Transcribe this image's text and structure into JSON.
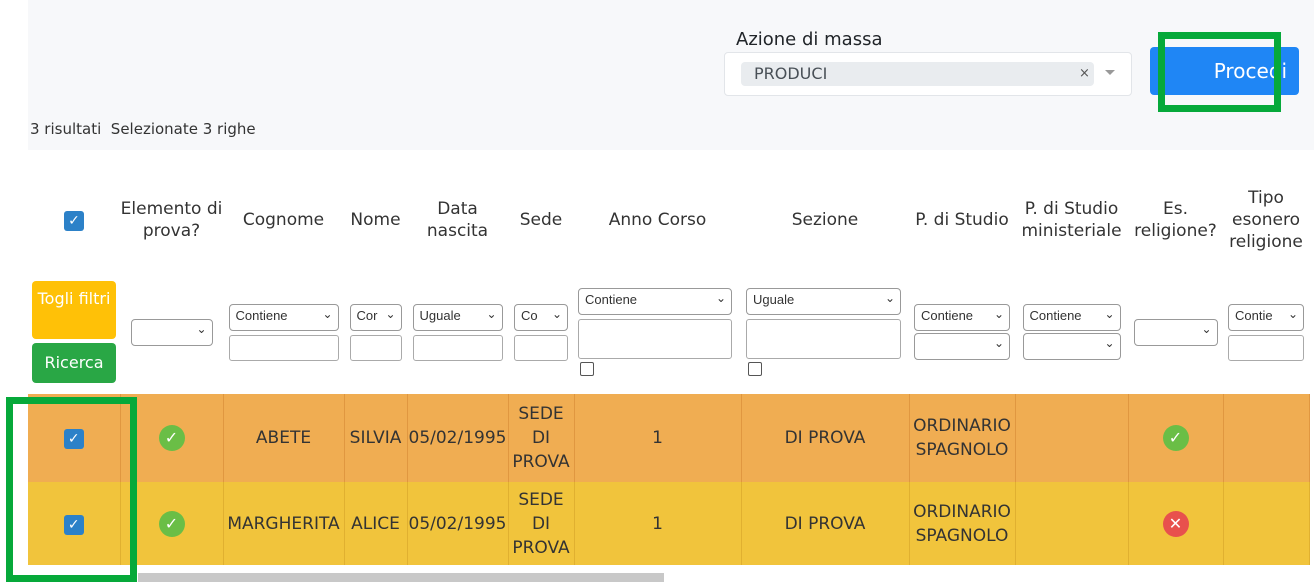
{
  "mass_action": {
    "label": "Azione di massa",
    "selected": "PRODUCI",
    "clear_symbol": "×"
  },
  "proceed_label": "Procedi",
  "results_text": "3 risultati  Selezionate 3 righe",
  "columns": {
    "elemento": "Elemento di prova?",
    "cognome": "Cognome",
    "nome": "Nome",
    "data": "Data nascita",
    "sede": "Sede",
    "anno": "Anno Corso",
    "sezione": "Sezione",
    "pstudio": "P. di Studio",
    "pmin": "P. di Studio ministeriale",
    "esrel": "Es. religione?",
    "tipo": "Tipo esonero religione"
  },
  "filters": {
    "togli": "Togli filtri",
    "ricerca": "Ricerca",
    "cognome": "Contiene",
    "nome": "Cor",
    "data": "Uguale",
    "sede": "Co",
    "anno": "Contiene",
    "sezione": "Uguale",
    "pstudio": "Contiene",
    "pmin": "Contiene",
    "tipo": "Contie"
  },
  "rows": [
    {
      "cognome": "ABETE",
      "nome": "SILVIA",
      "data": "05/02/1995",
      "sede": "SEDE DI PROVA",
      "anno": "1",
      "sezione": "DI PROVA",
      "pstudio": "ORDINARIO SPAGNOLO",
      "esrel": "yes"
    },
    {
      "cognome": "MARGHERITA",
      "nome": "ALICE",
      "data": "05/02/1995",
      "sede": "SEDE DI PROVA",
      "anno": "1",
      "sezione": "DI PROVA",
      "pstudio": "ORDINARIO SPAGNOLO",
      "esrel": "no"
    }
  ],
  "colors": {
    "row1": "#f0ad52",
    "row2": "#f1c43c",
    "accent": "#1f86f5",
    "highlight": "#06a93a"
  }
}
